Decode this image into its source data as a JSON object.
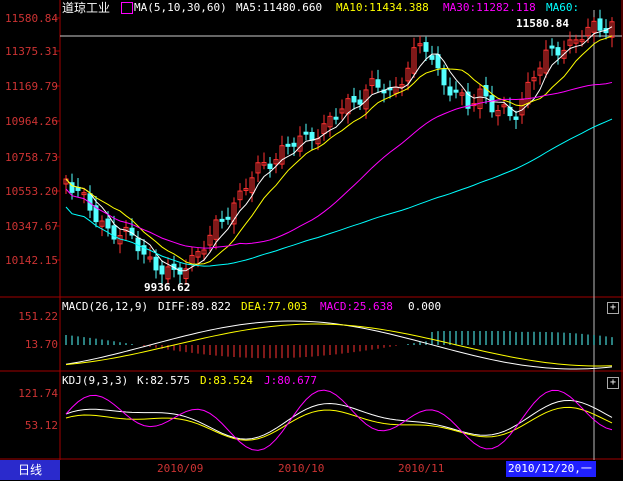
{
  "colors": {
    "up": "#ff3232",
    "down": "#54ffff",
    "ma5": "#ffffff",
    "ma10": "#ffff00",
    "ma30": "#ff00ff",
    "ma60": "#00ffff",
    "axis": "#a00000"
  },
  "header": {
    "title": "道琼工业",
    "ma_params": "MA(5,10,30,60)",
    "ma5": "MA5:11480.660",
    "ma10": "MA10:11434.388",
    "ma30": "MA30:11282.118",
    "ma60": "MA60:",
    "indicator_icon": "chart-toggle-icon"
  },
  "price_axis": [
    "11580.84",
    "11375.31",
    "11169.79",
    "10964.26",
    "10758.73",
    "10553.20",
    "10347.67",
    "10142.15"
  ],
  "price_annotations": {
    "high": "11580.84",
    "low": "9936.62"
  },
  "macd": {
    "params": "MACD(26,12,9)",
    "diff": "DIFF:89.822",
    "dea": "DEA:77.003",
    "macd": "MACD:25.638",
    "zero": "0.000",
    "axis": [
      "151.22",
      "13.70"
    ]
  },
  "kdj": {
    "params": "KDJ(9,3,3)",
    "k": "K:82.575",
    "d": "D:83.524",
    "j": "J:80.677",
    "axis": [
      "121.74",
      "53.12"
    ]
  },
  "x_axis": [
    "2010/09",
    "2010/10",
    "2010/11"
  ],
  "bottom": {
    "tab_label": "日线",
    "cursor_date": "2010/12/20,一"
  },
  "chart_data": {
    "type": "candlestick",
    "title": "道琼工业",
    "ylim": [
      9936.62,
      11580.84
    ],
    "high": 11580.84,
    "low": 9936.62,
    "x_ticks": [
      "2010/09",
      "2010/10",
      "2010/11"
    ],
    "ma_latest": {
      "MA5": 11480.66,
      "MA10": 11434.388,
      "MA30": 11282.118
    },
    "macd_latest": {
      "DIFF": 89.822,
      "DEA": 77.003,
      "MACD": 25.638
    },
    "kdj_latest": {
      "K": 82.575,
      "D": 83.524,
      "J": 80.677
    }
  }
}
